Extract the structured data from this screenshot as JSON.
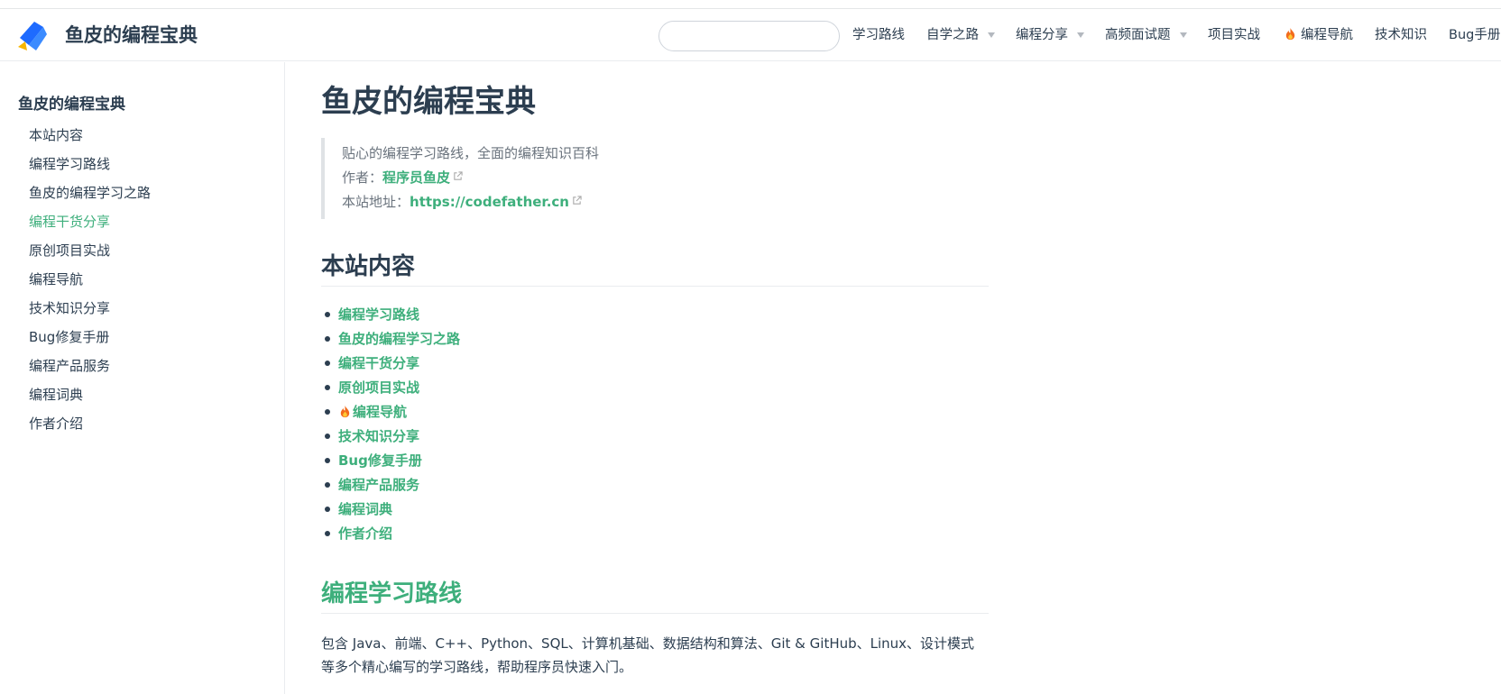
{
  "site": {
    "name": "鱼皮的编程宝典"
  },
  "nav": {
    "search_placeholder": "",
    "items": [
      {
        "label": "学习路线",
        "dropdown": false
      },
      {
        "label": "自学之路",
        "dropdown": true
      },
      {
        "label": "编程分享",
        "dropdown": true
      },
      {
        "label": "高频面试题",
        "dropdown": true
      },
      {
        "label": "项目实战",
        "dropdown": false
      },
      {
        "label": "编程导航",
        "dropdown": false,
        "icon": "fire-icon"
      },
      {
        "label": "技术知识",
        "dropdown": false
      },
      {
        "label": "Bug手册",
        "dropdown": false
      }
    ]
  },
  "sidebar": {
    "title": "鱼皮的编程宝典",
    "active_index": 3,
    "items": [
      "本站内容",
      "编程学习路线",
      "鱼皮的编程学习之路",
      "编程干货分享",
      "原创项目实战",
      "编程导航",
      "技术知识分享",
      "Bug修复手册",
      "编程产品服务",
      "编程词典",
      "作者介绍"
    ]
  },
  "content": {
    "title": "鱼皮的编程宝典",
    "quote": {
      "line1": "贴心的编程学习路线，全面的编程知识百科",
      "author_label": "作者：",
      "author_link": "程序员鱼皮",
      "site_label": "本站地址：",
      "site_link": "https://codefather.cn"
    },
    "section1": {
      "heading": "本站内容",
      "links": [
        "编程学习路线",
        "鱼皮的编程学习之路",
        "编程干货分享",
        "原创项目实战",
        "编程导航",
        "技术知识分享",
        "Bug修复手册",
        "编程产品服务",
        "编程词典",
        "作者介绍"
      ]
    },
    "section2": {
      "heading": "编程学习路线",
      "paragraph_line1": "包含 Java、前端、C++、Python、SQL、计算机基础、数据结构和算法、Git & GitHub、Linux、设计模式",
      "paragraph_line2": "等多个精心编写的学习路线，帮助程序员快速入门。"
    }
  },
  "colors": {
    "accent": "#3eaf7c",
    "text": "#2c3e50",
    "muted": "#6a737d",
    "border": "#eaecef"
  }
}
